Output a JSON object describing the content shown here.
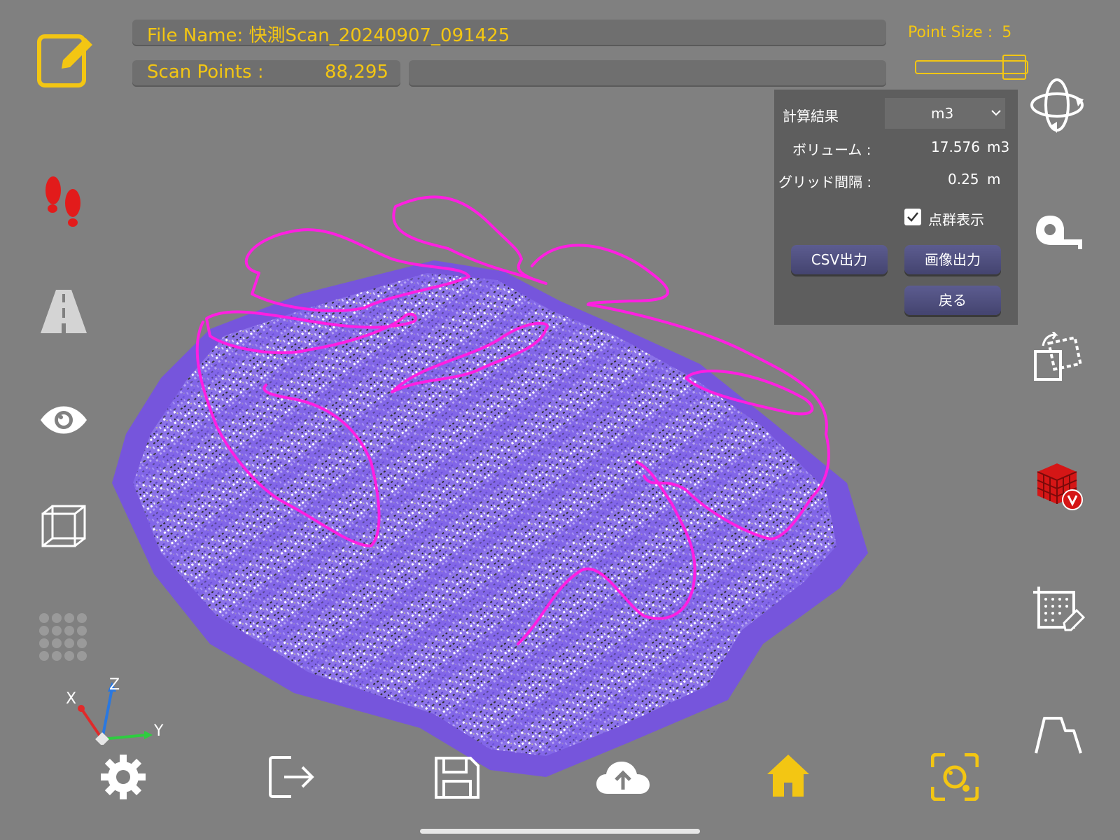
{
  "header": {
    "file_name": "File Name: 快測Scan_20240907_091425",
    "scan_points_label": "Scan Points :",
    "scan_points_value": "88,295",
    "point_size_label": "Point Size :",
    "point_size_value": "5",
    "point_size_fraction": 0.85
  },
  "panel": {
    "title": "計算結果",
    "unit_select": "m3",
    "volume_label": "ボリューム :",
    "volume_value": "17.576",
    "volume_unit": "m3",
    "grid_label": "グリッド間隔 :",
    "grid_value": "0.25",
    "grid_unit": "m",
    "pointcloud_checkbox_label": "点群表示",
    "pointcloud_checked": true,
    "csv_button": "CSV出力",
    "image_button": "画像出力",
    "back_button": "戻る"
  },
  "axes": {
    "x": "X",
    "y": "Y",
    "z": "Z"
  },
  "icons": {
    "left": [
      "edit-icon",
      "footprints-icon",
      "road-icon",
      "eye-icon",
      "wireframe-cube-icon",
      "dot-grid-icon"
    ],
    "right": [
      "orbit-rotate-icon",
      "tape-measure-icon",
      "transform-copy-icon",
      "voxel-volume-icon",
      "grid-erase-icon",
      "profile-section-icon"
    ],
    "bottom": [
      "settings-icon",
      "exit-icon",
      "save-icon",
      "cloud-upload-icon",
      "home-icon",
      "camera-capture-icon"
    ]
  },
  "colors": {
    "accent": "#f3c613",
    "background": "#808080",
    "voxel": "#7b5ce6",
    "boundary": "#ff1fe1"
  }
}
